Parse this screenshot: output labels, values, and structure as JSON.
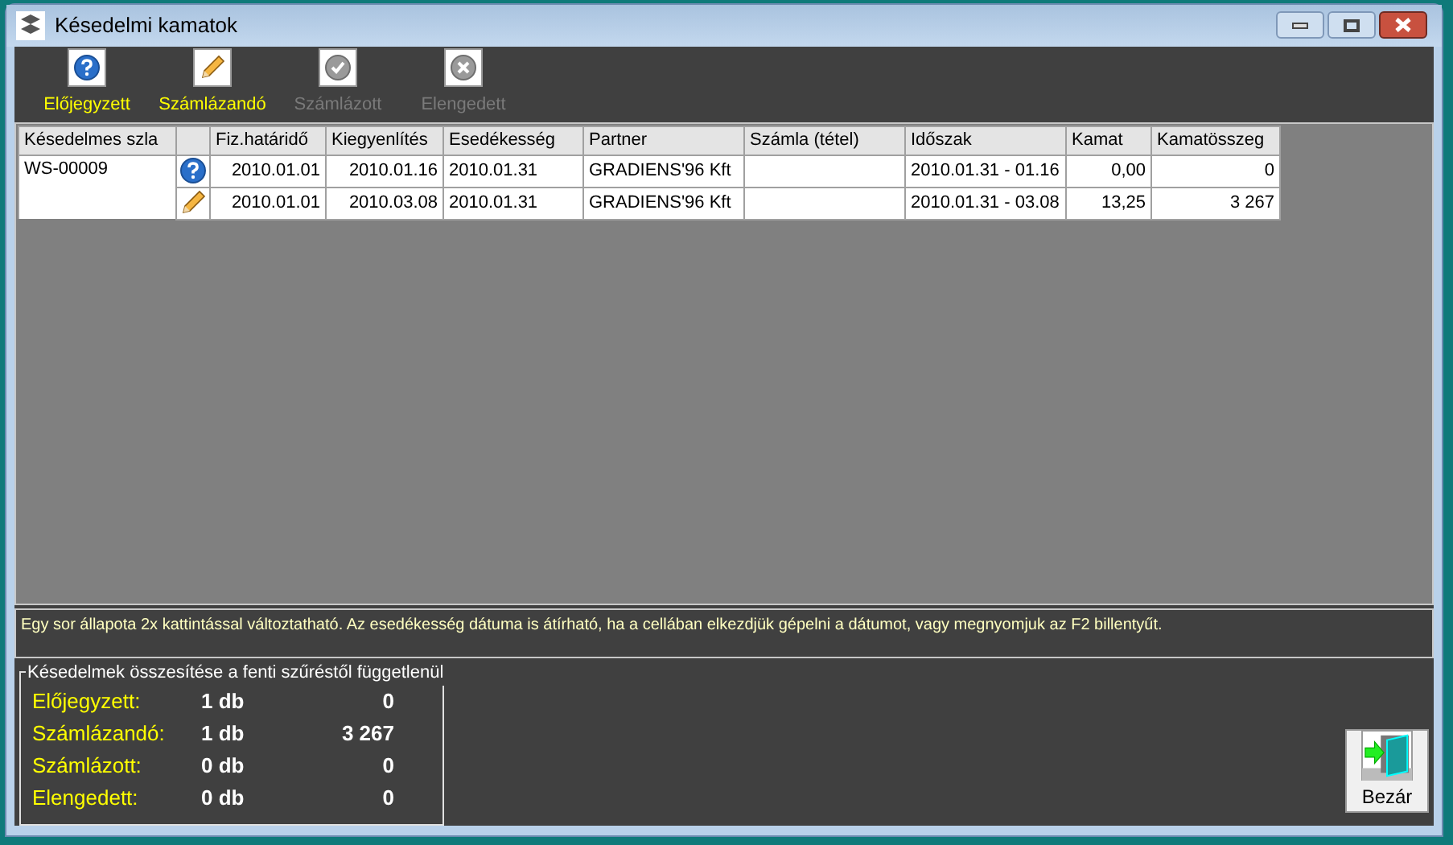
{
  "window": {
    "title": "Késedelmi kamatok"
  },
  "toolbar": [
    {
      "label": "Előjegyzett",
      "kind": "question",
      "disabled": false
    },
    {
      "label": "Számlázandó",
      "kind": "pencil",
      "disabled": false
    },
    {
      "label": "Számlázott",
      "kind": "check",
      "disabled": true
    },
    {
      "label": "Elengedett",
      "kind": "cross",
      "disabled": true
    }
  ],
  "table": {
    "columns": [
      "Késedelmes szla",
      "",
      "Fiz.határidő",
      "Kiegyenlítés",
      "Esedékesség",
      "Partner",
      "Számla (tétel)",
      "Időszak",
      "Kamat",
      "Kamatösszeg"
    ],
    "rows": [
      {
        "kind": "question",
        "cells": [
          "WS-00009",
          "",
          "2010.01.01",
          "2010.01.16",
          "2010.01.31",
          "GRADIENS'96 Kft",
          "",
          "2010.01.31 - 01.16",
          "0,00",
          "0"
        ]
      },
      {
        "kind": "pencil",
        "cells": [
          "",
          "",
          "2010.01.01",
          "2010.03.08",
          "2010.01.31",
          "GRADIENS'96 Kft",
          "",
          "2010.01.31 - 03.08",
          "13,25",
          "3 267"
        ]
      }
    ]
  },
  "hint": "Egy sor állapota 2x kattintással változtatható. Az esedékesség dátuma is átírható, ha a cellában elkezdjük gépelni a dátumot, vagy megnyomjuk az F2 billentyűt.",
  "summary": {
    "title": "Késedelmek összesítése a fenti szűréstől függetlenül",
    "rows": [
      {
        "label": "Előjegyzett:",
        "count": "1 db",
        "amount": "0"
      },
      {
        "label": "Számlázandó:",
        "count": "1 db",
        "amount": "3 267"
      },
      {
        "label": "Számlázott:",
        "count": "0 db",
        "amount": "0"
      },
      {
        "label": "Elengedett:",
        "count": "0 db",
        "amount": "0"
      }
    ]
  },
  "close_button": {
    "label": "Bezár"
  }
}
